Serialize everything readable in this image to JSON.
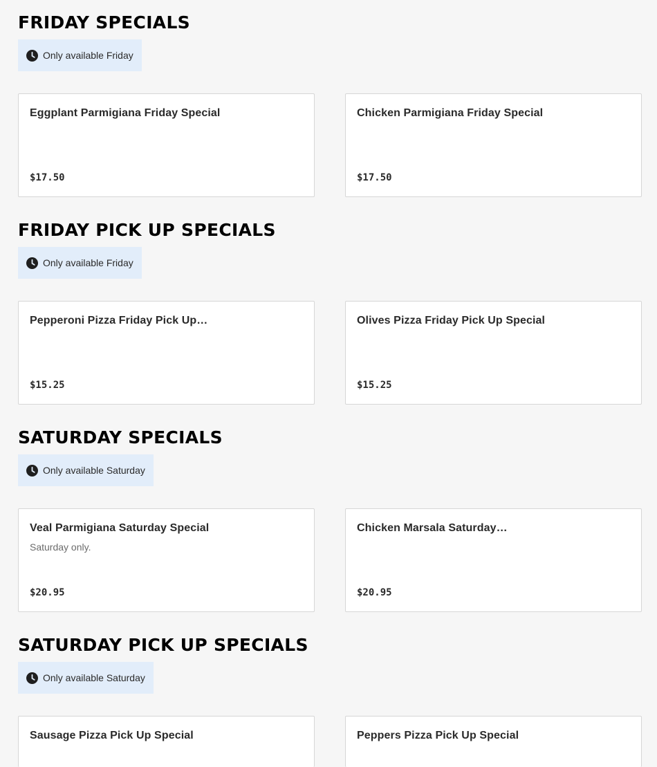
{
  "sections": [
    {
      "title": "FRIDAY SPECIALS",
      "availability": "Only available Friday",
      "items": [
        {
          "name": "Eggplant Parmigiana Friday Special",
          "description": "",
          "price": "$17.50"
        },
        {
          "name": "Chicken Parmigiana Friday Special",
          "description": "",
          "price": "$17.50"
        }
      ]
    },
    {
      "title": "FRIDAY PICK UP SPECIALS",
      "availability": "Only available Friday",
      "items": [
        {
          "name": "Pepperoni Pizza Friday Pick Up…",
          "description": "",
          "price": "$15.25"
        },
        {
          "name": "Olives Pizza Friday Pick Up Special",
          "description": "",
          "price": "$15.25"
        }
      ]
    },
    {
      "title": "SATURDAY SPECIALS",
      "availability": "Only available Saturday",
      "items": [
        {
          "name": "Veal Parmigiana Saturday Special",
          "description": "Saturday only.",
          "price": "$20.95"
        },
        {
          "name": "Chicken Marsala Saturday…",
          "description": "",
          "price": "$20.95"
        }
      ]
    },
    {
      "title": "SATURDAY PICK UP SPECIALS",
      "availability": "Only available Saturday",
      "items": [
        {
          "name": "Sausage Pizza Pick Up Special",
          "description": "",
          "price": ""
        },
        {
          "name": "Peppers Pizza Pick Up Special",
          "description": "",
          "price": ""
        }
      ]
    }
  ],
  "icons": {
    "availability": "clock-icon"
  },
  "colors": {
    "availability_background": "#e2edfa",
    "card_border": "#d6d6d6",
    "page_background": "#f6f6f6"
  }
}
